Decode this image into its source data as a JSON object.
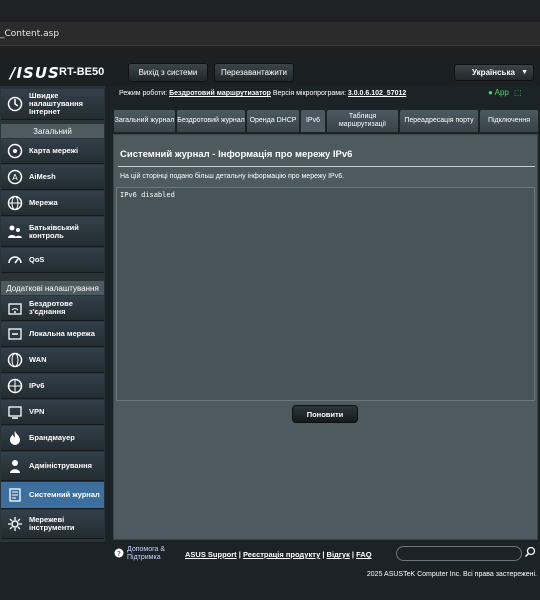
{
  "browser": {
    "url": "_Content.asp"
  },
  "header": {
    "logo": "/ISUS",
    "model": "RT-BE50",
    "logout_label": "Вихід з системи",
    "reboot_label": "Перезавантажити",
    "language": "Українська"
  },
  "status": {
    "mode_label": "Режим роботи:",
    "mode_value": "Бездротовий маршрутизатор",
    "firmware_label": "Версія мікропрограми:",
    "firmware_value": "3.0.0.6.102_57012",
    "app_label": "App"
  },
  "sidebar": {
    "quick": "Швидке налаштування Інтернет",
    "general_header": "Загальний",
    "general": [
      "Карта мережі",
      "AiMesh",
      "Мережа",
      "Батьківський контроль",
      "QoS"
    ],
    "advanced_header": "Додаткові налаштування",
    "advanced": [
      "Бездротове з'єднання",
      "Локальна мережа",
      "WAN",
      "IPv6",
      "VPN",
      "Брандмауер",
      "Адміністрування",
      "Системний журнал",
      "Мережеві інструменти"
    ]
  },
  "tabs": [
    "Загальний журнал",
    "Бездротовий журнал",
    "Оренда DHCP",
    "IPv6",
    "Таблиця маршрутизації",
    "Переадресація порту",
    "Підключення"
  ],
  "panel": {
    "title": "Системний журнал - Інформація про мережу IPv6",
    "description": "На цій сторінці подано більш детальну інформацію про мережу IPv6.",
    "log_text": "IPv6 disabled",
    "refresh_label": "Поновити"
  },
  "footer": {
    "help_label_1": "Допомога &",
    "help_label_2": "Підтримка",
    "links": [
      "ASUS Support",
      "Реєстрація продукту",
      "Відгук",
      "FAQ"
    ],
    "copyright": "2025 ASUSTeK Computer Inc. Всі права застережені."
  },
  "colors": {
    "accent_active": "#3c6f9e",
    "panel_bg": "#4d5a60",
    "app_green": "#4cd964"
  }
}
